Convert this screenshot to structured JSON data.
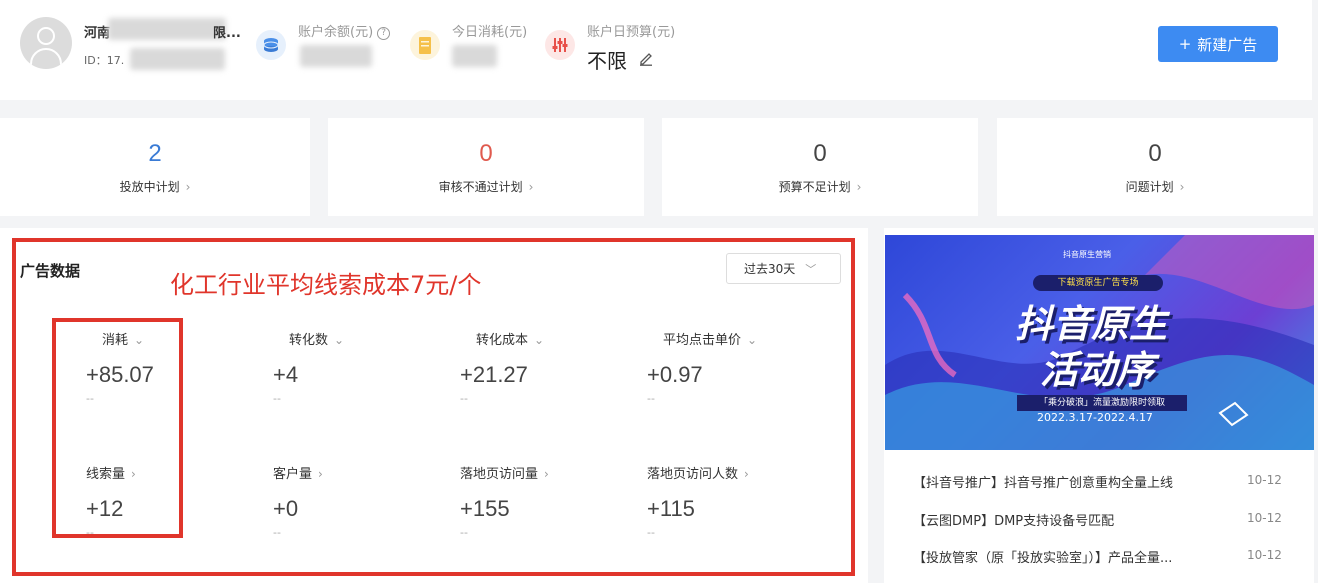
{
  "account": {
    "name_prefix": "河南",
    "name_suffix": "限...",
    "id_label": "ID：17."
  },
  "metrics": {
    "balance_label": "账户余额(元)",
    "balance_help": "?",
    "spend_today_label": "今日消耗(元)",
    "daily_budget_label": "账户日预算(元)",
    "daily_budget_value": "不限"
  },
  "new_ad_button": {
    "icon": "+",
    "label": "新建广告"
  },
  "stat_cards": [
    {
      "value": "2",
      "label": "投放中计划",
      "color": "#3a7bd5"
    },
    {
      "value": "0",
      "label": "审核不通过计划",
      "color": "#e05a4e"
    },
    {
      "value": "0",
      "label": "预算不足计划",
      "color": "#444444"
    },
    {
      "value": "0",
      "label": "问题计划",
      "color": "#444444"
    }
  ],
  "ad_data": {
    "title": "广告数据",
    "annotation": "化工行业平均线索成本7元/个",
    "range": "过去30天",
    "row1": [
      {
        "label": "消耗",
        "value": "+85.07",
        "sub": "--",
        "chevron": "⌄"
      },
      {
        "label": "转化数",
        "value": "+4",
        "sub": "--",
        "chevron": "⌄"
      },
      {
        "label": "转化成本",
        "value": "+21.27",
        "sub": "--",
        "chevron": "⌄"
      },
      {
        "label": "平均点击单价",
        "value": "+0.97",
        "sub": "--",
        "chevron": "⌄"
      }
    ],
    "row2": [
      {
        "label": "线索量",
        "value": "+12",
        "sub": "--",
        "chevron": "›"
      },
      {
        "label": "客户量",
        "value": "+0",
        "sub": "--",
        "chevron": "›"
      },
      {
        "label": "落地页访问量",
        "value": "+155",
        "sub": "--",
        "chevron": "›"
      },
      {
        "label": "落地页访问人数",
        "value": "+115",
        "sub": "--",
        "chevron": "›"
      }
    ]
  },
  "banner": {
    "brand": "抖音原生营销",
    "ribbon": "下载资原生广告专场",
    "headline_1": "抖音原生",
    "headline_2": "活动序",
    "subline": "「乘分破浪」流量激励限时领取",
    "dates": "2022.3.17-2022.4.17"
  },
  "news": [
    {
      "title": "【抖音号推广】抖音号推广创意重构全量上线",
      "date": "10-12"
    },
    {
      "title": "【云图DMP】DMP支持设备号匹配",
      "date": "10-12"
    },
    {
      "title": "【投放管家（原「投放实验室」）】产品全量...",
      "date": "10-12"
    }
  ]
}
